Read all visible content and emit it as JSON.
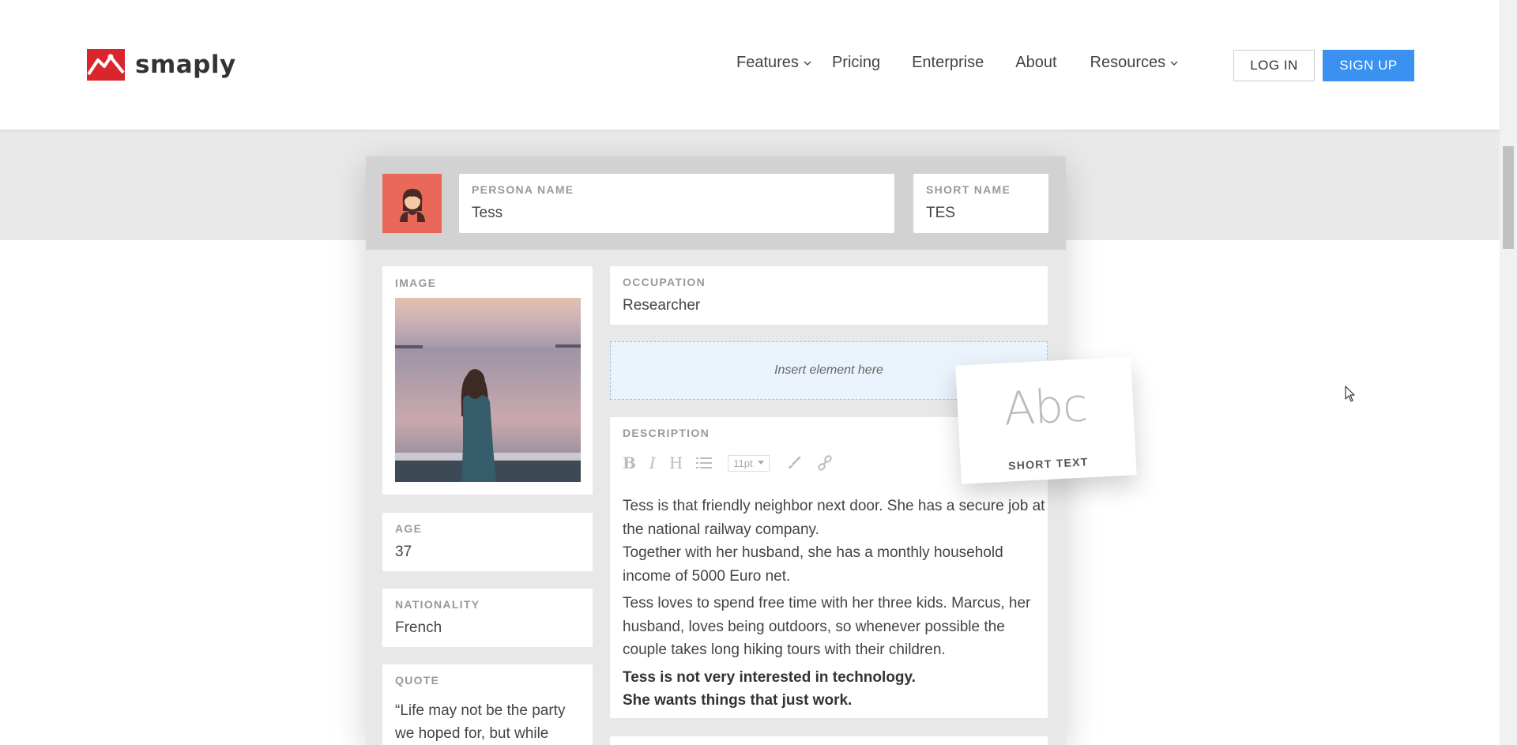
{
  "brand": {
    "name": "smaply",
    "color": "#d9262c"
  },
  "nav": {
    "items": [
      {
        "label": "Features",
        "has_dropdown": true
      },
      {
        "label": "Pricing",
        "has_dropdown": false
      },
      {
        "label": "Enterprise",
        "has_dropdown": false
      },
      {
        "label": "About",
        "has_dropdown": false
      },
      {
        "label": "Resources",
        "has_dropdown": true
      }
    ],
    "login_label": "LOG IN",
    "signup_label": "SIGN UP",
    "signup_color": "#3a91f0"
  },
  "persona": {
    "avatar_color": "#e8685a",
    "name_label": "PERSONA NAME",
    "name_value": "Tess",
    "short_name_label": "SHORT NAME",
    "short_name_value": "TES",
    "image_label": "IMAGE",
    "age_label": "AGE",
    "age_value": "37",
    "nationality_label": "NATIONALITY",
    "nationality_value": "French",
    "quote_label": "QUOTE",
    "quote_value": "“Life may not be the party we hoped for, but while",
    "occupation_label": "OCCUPATION",
    "occupation_value": "Researcher",
    "insert_placeholder": "Insert element here",
    "description_label": "DESCRIPTION",
    "toolbar": {
      "bold": "B",
      "italic": "I",
      "heading": "H",
      "font_size": "11pt"
    },
    "description": {
      "p1": "Tess is that friendly neighbor next door. She has a secure job at the national railway company.",
      "p1b": "Together with her husband, she has a monthly household income of 5000 Euro net.",
      "p2": "Tess loves to spend free time with her three kids. Marcus, her husband, loves being outdoors, so whenever possible the couple takes long hiking tours with their children.",
      "p3a": "Tess is not very interested in technology.",
      "p3b": "She wants things that just work."
    }
  },
  "drag_element": {
    "preview": "Abc",
    "label": "SHORT TEXT"
  }
}
